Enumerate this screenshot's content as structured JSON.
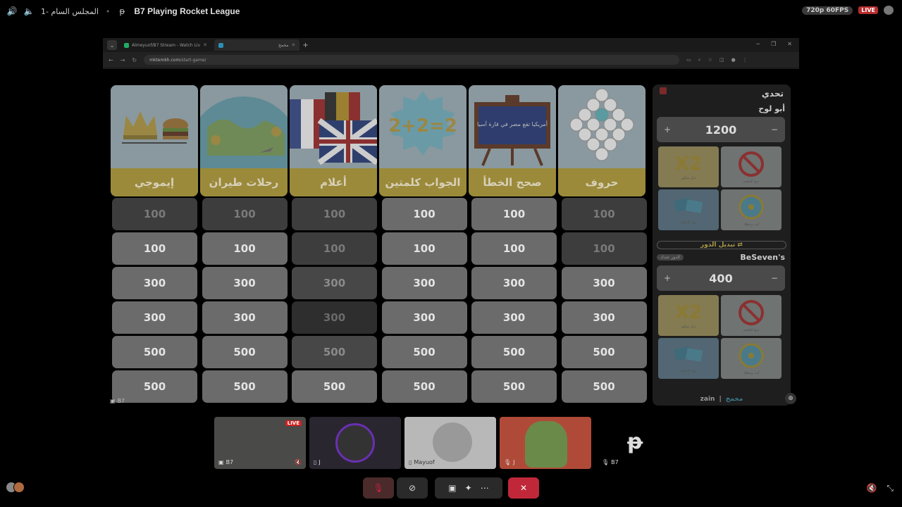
{
  "topbar": {
    "channel": "المجلس السام -1",
    "stream_title": "B7 Playing Rocket League",
    "quality": "720p 60FPS",
    "live": "LIVE"
  },
  "browser": {
    "tab1": "Almeyuof/B7 Stream - Watch Liv",
    "tab2": "مخمخ",
    "url_domain": "mktemkh.com",
    "url_path": "/start-game/"
  },
  "board": {
    "categories": [
      "إيموجي",
      "رحلات طيران",
      "أعلام",
      "الجواب كلمتين",
      "صحح الخطأ",
      "حروف"
    ],
    "category_icons": [
      "crown-burger-icon",
      "globe-plane-icon",
      "flags-icon",
      "math-puzzle-icon",
      "chalkboard-icon",
      "letter-grid-icon"
    ],
    "chalkboard_text": "أمريكيا تقع مصر في قارة آسيا",
    "puzzle_text": "2+2=2",
    "rows": [
      [
        "100",
        "100",
        "100",
        "100",
        "100",
        "100"
      ],
      [
        "100",
        "100",
        "100",
        "100",
        "100",
        "100"
      ],
      [
        "300",
        "300",
        "300",
        "300",
        "300",
        "300"
      ],
      [
        "300",
        "300",
        "300",
        "300",
        "300",
        "300"
      ],
      [
        "500",
        "500",
        "500",
        "500",
        "500",
        "500"
      ],
      [
        "500",
        "500",
        "500",
        "500",
        "500",
        "500"
      ]
    ],
    "presenter_tag": "B7"
  },
  "panel": {
    "title": "تحدي",
    "team1": {
      "name": "أبو لوح",
      "score": "1200"
    },
    "team2": {
      "name": "BeSeven's",
      "score": "400",
      "turn": "الدور عندك"
    },
    "switch_turn": "تبديل الدور",
    "plus": "+",
    "minus": "−",
    "card_double": "X2",
    "card_caps": [
      "دبل سكور",
      "منع الخصم",
      "بوق السؤال",
      "أنت وحظك"
    ],
    "footer_zain": "zain",
    "footer_brand": "مخمخ"
  },
  "tiles": [
    {
      "label": "B7",
      "live": "LIVE"
    },
    {
      "label": "J"
    },
    {
      "label": "Mayuof"
    },
    {
      "label": "J"
    },
    {
      "label": "B7"
    }
  ],
  "colors": {
    "live_red": "#c0283a",
    "category_band": "#9b8a3a",
    "cell": "#6b6b6b"
  }
}
